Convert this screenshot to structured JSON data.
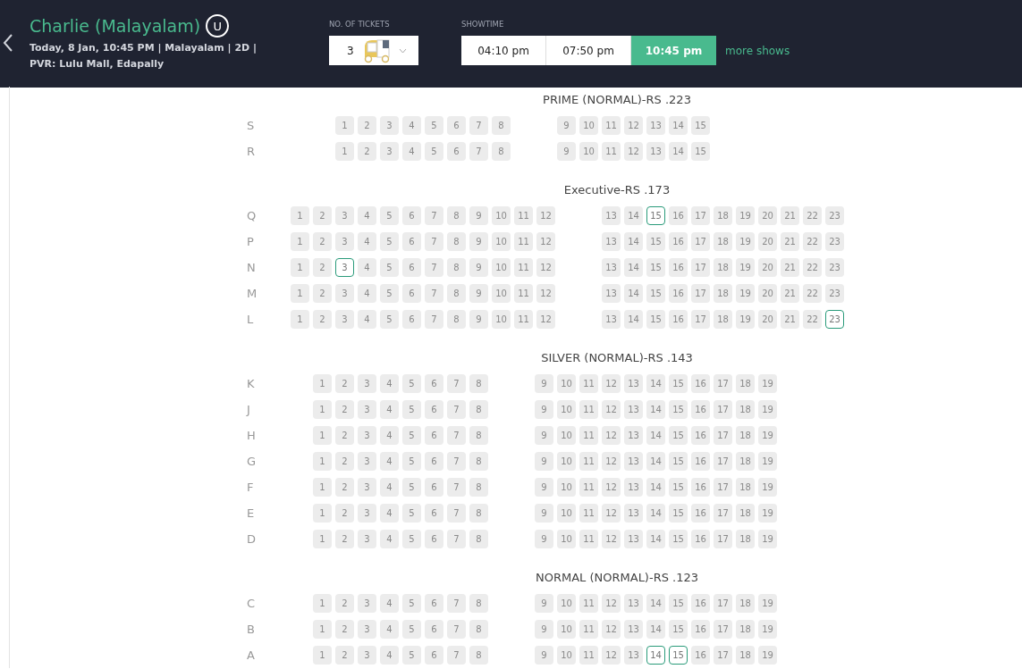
{
  "header": {
    "title": "Charlie (Malayalam)",
    "rating": "U",
    "details": [
      "Today, 8 Jan, 10:45 PM | Malayalam | 2D |",
      "PVR: Lulu Mall, Edapally"
    ]
  },
  "tickets": {
    "label": "NO. OF TICKETS",
    "value": "3"
  },
  "showtime": {
    "label": "SHOWTIME",
    "times": [
      {
        "time": "04:10 pm",
        "selected": false
      },
      {
        "time": "07:50 pm",
        "selected": false
      },
      {
        "time": "10:45 pm",
        "selected": true
      }
    ],
    "more": "more shows"
  },
  "sections": [
    {
      "title": "PRIME (NORMAL)-RS .223",
      "rows": [
        {
          "label": "S",
          "blocks": [
            [
              {
                "n": "1",
                "available": false
              },
              {
                "n": "2",
                "available": false
              },
              {
                "n": "3",
                "available": false
              },
              {
                "n": "4",
                "available": false
              },
              {
                "n": "5",
                "available": false
              },
              {
                "n": "6",
                "available": false
              },
              {
                "n": "7",
                "available": false
              },
              {
                "n": "8",
                "available": false
              }
            ],
            [
              {
                "n": "9",
                "available": false
              },
              {
                "n": "10",
                "available": false
              },
              {
                "n": "11",
                "available": false
              },
              {
                "n": "12",
                "available": false
              },
              {
                "n": "13",
                "available": false
              },
              {
                "n": "14",
                "available": false
              },
              {
                "n": "15",
                "available": false
              }
            ]
          ]
        },
        {
          "label": "R",
          "blocks": [
            [
              {
                "n": "1",
                "available": false
              },
              {
                "n": "2",
                "available": false
              },
              {
                "n": "3",
                "available": false
              },
              {
                "n": "4",
                "available": false
              },
              {
                "n": "5",
                "available": false
              },
              {
                "n": "6",
                "available": false
              },
              {
                "n": "7",
                "available": false
              },
              {
                "n": "8",
                "available": false
              }
            ],
            [
              {
                "n": "9",
                "available": false
              },
              {
                "n": "10",
                "available": false
              },
              {
                "n": "11",
                "available": false
              },
              {
                "n": "12",
                "available": false
              },
              {
                "n": "13",
                "available": false
              },
              {
                "n": "14",
                "available": false
              },
              {
                "n": "15",
                "available": false
              }
            ]
          ]
        }
      ]
    },
    {
      "title": "Executive-RS .173",
      "rows": [
        {
          "label": "Q",
          "blocks": [
            [
              {
                "n": "1",
                "available": false
              },
              {
                "n": "2",
                "available": false
              },
              {
                "n": "3",
                "available": false
              },
              {
                "n": "4",
                "available": false
              },
              {
                "n": "5",
                "available": false
              },
              {
                "n": "6",
                "available": false
              },
              {
                "n": "7",
                "available": false
              },
              {
                "n": "8",
                "available": false
              },
              {
                "n": "9",
                "available": false
              },
              {
                "n": "10",
                "available": false
              },
              {
                "n": "11",
                "available": false
              },
              {
                "n": "12",
                "available": false
              }
            ],
            [
              {
                "n": "13",
                "available": false
              },
              {
                "n": "14",
                "available": false
              },
              {
                "n": "15",
                "available": true
              },
              {
                "n": "16",
                "available": false
              },
              {
                "n": "17",
                "available": false
              },
              {
                "n": "18",
                "available": false
              },
              {
                "n": "19",
                "available": false
              },
              {
                "n": "20",
                "available": false
              },
              {
                "n": "21",
                "available": false
              },
              {
                "n": "22",
                "available": false
              },
              {
                "n": "23",
                "available": false
              }
            ]
          ]
        },
        {
          "label": "P",
          "blocks": [
            [
              {
                "n": "1",
                "available": false
              },
              {
                "n": "2",
                "available": false
              },
              {
                "n": "3",
                "available": false
              },
              {
                "n": "4",
                "available": false
              },
              {
                "n": "5",
                "available": false
              },
              {
                "n": "6",
                "available": false
              },
              {
                "n": "7",
                "available": false
              },
              {
                "n": "8",
                "available": false
              },
              {
                "n": "9",
                "available": false
              },
              {
                "n": "10",
                "available": false
              },
              {
                "n": "11",
                "available": false
              },
              {
                "n": "12",
                "available": false
              }
            ],
            [
              {
                "n": "13",
                "available": false
              },
              {
                "n": "14",
                "available": false
              },
              {
                "n": "15",
                "available": false
              },
              {
                "n": "16",
                "available": false
              },
              {
                "n": "17",
                "available": false
              },
              {
                "n": "18",
                "available": false
              },
              {
                "n": "19",
                "available": false
              },
              {
                "n": "20",
                "available": false
              },
              {
                "n": "21",
                "available": false
              },
              {
                "n": "22",
                "available": false
              },
              {
                "n": "23",
                "available": false
              }
            ]
          ]
        },
        {
          "label": "N",
          "blocks": [
            [
              {
                "n": "1",
                "available": false
              },
              {
                "n": "2",
                "available": false
              },
              {
                "n": "3",
                "available": true
              },
              {
                "n": "4",
                "available": false
              },
              {
                "n": "5",
                "available": false
              },
              {
                "n": "6",
                "available": false
              },
              {
                "n": "7",
                "available": false
              },
              {
                "n": "8",
                "available": false
              },
              {
                "n": "9",
                "available": false
              },
              {
                "n": "10",
                "available": false
              },
              {
                "n": "11",
                "available": false
              },
              {
                "n": "12",
                "available": false
              }
            ],
            [
              {
                "n": "13",
                "available": false
              },
              {
                "n": "14",
                "available": false
              },
              {
                "n": "15",
                "available": false
              },
              {
                "n": "16",
                "available": false
              },
              {
                "n": "17",
                "available": false
              },
              {
                "n": "18",
                "available": false
              },
              {
                "n": "19",
                "available": false
              },
              {
                "n": "20",
                "available": false
              },
              {
                "n": "21",
                "available": false
              },
              {
                "n": "22",
                "available": false
              },
              {
                "n": "23",
                "available": false
              }
            ]
          ]
        },
        {
          "label": "M",
          "blocks": [
            [
              {
                "n": "1",
                "available": false
              },
              {
                "n": "2",
                "available": false
              },
              {
                "n": "3",
                "available": false
              },
              {
                "n": "4",
                "available": false
              },
              {
                "n": "5",
                "available": false
              },
              {
                "n": "6",
                "available": false
              },
              {
                "n": "7",
                "available": false
              },
              {
                "n": "8",
                "available": false
              },
              {
                "n": "9",
                "available": false
              },
              {
                "n": "10",
                "available": false
              },
              {
                "n": "11",
                "available": false
              },
              {
                "n": "12",
                "available": false
              }
            ],
            [
              {
                "n": "13",
                "available": false
              },
              {
                "n": "14",
                "available": false
              },
              {
                "n": "15",
                "available": false
              },
              {
                "n": "16",
                "available": false
              },
              {
                "n": "17",
                "available": false
              },
              {
                "n": "18",
                "available": false
              },
              {
                "n": "19",
                "available": false
              },
              {
                "n": "20",
                "available": false
              },
              {
                "n": "21",
                "available": false
              },
              {
                "n": "22",
                "available": false
              },
              {
                "n": "23",
                "available": false
              }
            ]
          ]
        },
        {
          "label": "L",
          "blocks": [
            [
              {
                "n": "1",
                "available": false
              },
              {
                "n": "2",
                "available": false
              },
              {
                "n": "3",
                "available": false
              },
              {
                "n": "4",
                "available": false
              },
              {
                "n": "5",
                "available": false
              },
              {
                "n": "6",
                "available": false
              },
              {
                "n": "7",
                "available": false
              },
              {
                "n": "8",
                "available": false
              },
              {
                "n": "9",
                "available": false
              },
              {
                "n": "10",
                "available": false
              },
              {
                "n": "11",
                "available": false
              },
              {
                "n": "12",
                "available": false
              }
            ],
            [
              {
                "n": "13",
                "available": false
              },
              {
                "n": "14",
                "available": false
              },
              {
                "n": "15",
                "available": false
              },
              {
                "n": "16",
                "available": false
              },
              {
                "n": "17",
                "available": false
              },
              {
                "n": "18",
                "available": false
              },
              {
                "n": "19",
                "available": false
              },
              {
                "n": "20",
                "available": false
              },
              {
                "n": "21",
                "available": false
              },
              {
                "n": "22",
                "available": false
              },
              {
                "n": "23",
                "available": true
              }
            ]
          ]
        }
      ]
    },
    {
      "title": "SILVER (NORMAL)-RS .143",
      "rows": [
        {
          "label": "K",
          "blocks": [
            [
              {
                "n": "1",
                "available": false
              },
              {
                "n": "2",
                "available": false
              },
              {
                "n": "3",
                "available": false
              },
              {
                "n": "4",
                "available": false
              },
              {
                "n": "5",
                "available": false
              },
              {
                "n": "6",
                "available": false
              },
              {
                "n": "7",
                "available": false
              },
              {
                "n": "8",
                "available": false
              }
            ],
            [
              {
                "n": "9",
                "available": false
              },
              {
                "n": "10",
                "available": false
              },
              {
                "n": "11",
                "available": false
              },
              {
                "n": "12",
                "available": false
              },
              {
                "n": "13",
                "available": false
              },
              {
                "n": "14",
                "available": false
              },
              {
                "n": "15",
                "available": false
              },
              {
                "n": "16",
                "available": false
              },
              {
                "n": "17",
                "available": false
              },
              {
                "n": "18",
                "available": false
              },
              {
                "n": "19",
                "available": false
              }
            ]
          ]
        },
        {
          "label": "J",
          "blocks": [
            [
              {
                "n": "1",
                "available": false
              },
              {
                "n": "2",
                "available": false
              },
              {
                "n": "3",
                "available": false
              },
              {
                "n": "4",
                "available": false
              },
              {
                "n": "5",
                "available": false
              },
              {
                "n": "6",
                "available": false
              },
              {
                "n": "7",
                "available": false
              },
              {
                "n": "8",
                "available": false
              }
            ],
            [
              {
                "n": "9",
                "available": false
              },
              {
                "n": "10",
                "available": false
              },
              {
                "n": "11",
                "available": false
              },
              {
                "n": "12",
                "available": false
              },
              {
                "n": "13",
                "available": false
              },
              {
                "n": "14",
                "available": false
              },
              {
                "n": "15",
                "available": false
              },
              {
                "n": "16",
                "available": false
              },
              {
                "n": "17",
                "available": false
              },
              {
                "n": "18",
                "available": false
              },
              {
                "n": "19",
                "available": false
              }
            ]
          ]
        },
        {
          "label": "H",
          "blocks": [
            [
              {
                "n": "1",
                "available": false
              },
              {
                "n": "2",
                "available": false
              },
              {
                "n": "3",
                "available": false
              },
              {
                "n": "4",
                "available": false
              },
              {
                "n": "5",
                "available": false
              },
              {
                "n": "6",
                "available": false
              },
              {
                "n": "7",
                "available": false
              },
              {
                "n": "8",
                "available": false
              }
            ],
            [
              {
                "n": "9",
                "available": false
              },
              {
                "n": "10",
                "available": false
              },
              {
                "n": "11",
                "available": false
              },
              {
                "n": "12",
                "available": false
              },
              {
                "n": "13",
                "available": false
              },
              {
                "n": "14",
                "available": false
              },
              {
                "n": "15",
                "available": false
              },
              {
                "n": "16",
                "available": false
              },
              {
                "n": "17",
                "available": false
              },
              {
                "n": "18",
                "available": false
              },
              {
                "n": "19",
                "available": false
              }
            ]
          ]
        },
        {
          "label": "G",
          "blocks": [
            [
              {
                "n": "1",
                "available": false
              },
              {
                "n": "2",
                "available": false
              },
              {
                "n": "3",
                "available": false
              },
              {
                "n": "4",
                "available": false
              },
              {
                "n": "5",
                "available": false
              },
              {
                "n": "6",
                "available": false
              },
              {
                "n": "7",
                "available": false
              },
              {
                "n": "8",
                "available": false
              }
            ],
            [
              {
                "n": "9",
                "available": false
              },
              {
                "n": "10",
                "available": false
              },
              {
                "n": "11",
                "available": false
              },
              {
                "n": "12",
                "available": false
              },
              {
                "n": "13",
                "available": false
              },
              {
                "n": "14",
                "available": false
              },
              {
                "n": "15",
                "available": false
              },
              {
                "n": "16",
                "available": false
              },
              {
                "n": "17",
                "available": false
              },
              {
                "n": "18",
                "available": false
              },
              {
                "n": "19",
                "available": false
              }
            ]
          ]
        },
        {
          "label": "F",
          "blocks": [
            [
              {
                "n": "1",
                "available": false
              },
              {
                "n": "2",
                "available": false
              },
              {
                "n": "3",
                "available": false
              },
              {
                "n": "4",
                "available": false
              },
              {
                "n": "5",
                "available": false
              },
              {
                "n": "6",
                "available": false
              },
              {
                "n": "7",
                "available": false
              },
              {
                "n": "8",
                "available": false
              }
            ],
            [
              {
                "n": "9",
                "available": false
              },
              {
                "n": "10",
                "available": false
              },
              {
                "n": "11",
                "available": false
              },
              {
                "n": "12",
                "available": false
              },
              {
                "n": "13",
                "available": false
              },
              {
                "n": "14",
                "available": false
              },
              {
                "n": "15",
                "available": false
              },
              {
                "n": "16",
                "available": false
              },
              {
                "n": "17",
                "available": false
              },
              {
                "n": "18",
                "available": false
              },
              {
                "n": "19",
                "available": false
              }
            ]
          ]
        },
        {
          "label": "E",
          "blocks": [
            [
              {
                "n": "1",
                "available": false
              },
              {
                "n": "2",
                "available": false
              },
              {
                "n": "3",
                "available": false
              },
              {
                "n": "4",
                "available": false
              },
              {
                "n": "5",
                "available": false
              },
              {
                "n": "6",
                "available": false
              },
              {
                "n": "7",
                "available": false
              },
              {
                "n": "8",
                "available": false
              }
            ],
            [
              {
                "n": "9",
                "available": false
              },
              {
                "n": "10",
                "available": false
              },
              {
                "n": "11",
                "available": false
              },
              {
                "n": "12",
                "available": false
              },
              {
                "n": "13",
                "available": false
              },
              {
                "n": "14",
                "available": false
              },
              {
                "n": "15",
                "available": false
              },
              {
                "n": "16",
                "available": false
              },
              {
                "n": "17",
                "available": false
              },
              {
                "n": "18",
                "available": false
              },
              {
                "n": "19",
                "available": false
              }
            ]
          ]
        },
        {
          "label": "D",
          "blocks": [
            [
              {
                "n": "1",
                "available": false
              },
              {
                "n": "2",
                "available": false
              },
              {
                "n": "3",
                "available": false
              },
              {
                "n": "4",
                "available": false
              },
              {
                "n": "5",
                "available": false
              },
              {
                "n": "6",
                "available": false
              },
              {
                "n": "7",
                "available": false
              },
              {
                "n": "8",
                "available": false
              }
            ],
            [
              {
                "n": "9",
                "available": false
              },
              {
                "n": "10",
                "available": false
              },
              {
                "n": "11",
                "available": false
              },
              {
                "n": "12",
                "available": false
              },
              {
                "n": "13",
                "available": false
              },
              {
                "n": "14",
                "available": false
              },
              {
                "n": "15",
                "available": false
              },
              {
                "n": "16",
                "available": false
              },
              {
                "n": "17",
                "available": false
              },
              {
                "n": "18",
                "available": false
              },
              {
                "n": "19",
                "available": false
              }
            ]
          ]
        }
      ]
    },
    {
      "title": "NORMAL (NORMAL)-RS .123",
      "rows": [
        {
          "label": "C",
          "blocks": [
            [
              {
                "n": "1",
                "available": false
              },
              {
                "n": "2",
                "available": false
              },
              {
                "n": "3",
                "available": false
              },
              {
                "n": "4",
                "available": false
              },
              {
                "n": "5",
                "available": false
              },
              {
                "n": "6",
                "available": false
              },
              {
                "n": "7",
                "available": false
              },
              {
                "n": "8",
                "available": false
              }
            ],
            [
              {
                "n": "9",
                "available": false
              },
              {
                "n": "10",
                "available": false
              },
              {
                "n": "11",
                "available": false
              },
              {
                "n": "12",
                "available": false
              },
              {
                "n": "13",
                "available": false
              },
              {
                "n": "14",
                "available": false
              },
              {
                "n": "15",
                "available": false
              },
              {
                "n": "16",
                "available": false
              },
              {
                "n": "17",
                "available": false
              },
              {
                "n": "18",
                "available": false
              },
              {
                "n": "19",
                "available": false
              }
            ]
          ]
        },
        {
          "label": "B",
          "blocks": [
            [
              {
                "n": "1",
                "available": false
              },
              {
                "n": "2",
                "available": false
              },
              {
                "n": "3",
                "available": false
              },
              {
                "n": "4",
                "available": false
              },
              {
                "n": "5",
                "available": false
              },
              {
                "n": "6",
                "available": false
              },
              {
                "n": "7",
                "available": false
              },
              {
                "n": "8",
                "available": false
              }
            ],
            [
              {
                "n": "9",
                "available": false
              },
              {
                "n": "10",
                "available": false
              },
              {
                "n": "11",
                "available": false
              },
              {
                "n": "12",
                "available": false
              },
              {
                "n": "13",
                "available": false
              },
              {
                "n": "14",
                "available": false
              },
              {
                "n": "15",
                "available": false
              },
              {
                "n": "16",
                "available": false
              },
              {
                "n": "17",
                "available": false
              },
              {
                "n": "18",
                "available": false
              },
              {
                "n": "19",
                "available": false
              }
            ]
          ]
        },
        {
          "label": "A",
          "blocks": [
            [
              {
                "n": "1",
                "available": false
              },
              {
                "n": "2",
                "available": false
              },
              {
                "n": "3",
                "available": false
              },
              {
                "n": "4",
                "available": false
              },
              {
                "n": "5",
                "available": false
              },
              {
                "n": "6",
                "available": false
              },
              {
                "n": "7",
                "available": false
              },
              {
                "n": "8",
                "available": false
              }
            ],
            [
              {
                "n": "9",
                "available": false
              },
              {
                "n": "10",
                "available": false
              },
              {
                "n": "11",
                "available": false
              },
              {
                "n": "12",
                "available": false
              },
              {
                "n": "13",
                "available": false
              },
              {
                "n": "14",
                "available": true
              },
              {
                "n": "15",
                "available": true
              },
              {
                "n": "16",
                "available": false
              },
              {
                "n": "17",
                "available": false
              },
              {
                "n": "18",
                "available": false
              },
              {
                "n": "19",
                "available": false
              }
            ]
          ]
        }
      ]
    }
  ]
}
